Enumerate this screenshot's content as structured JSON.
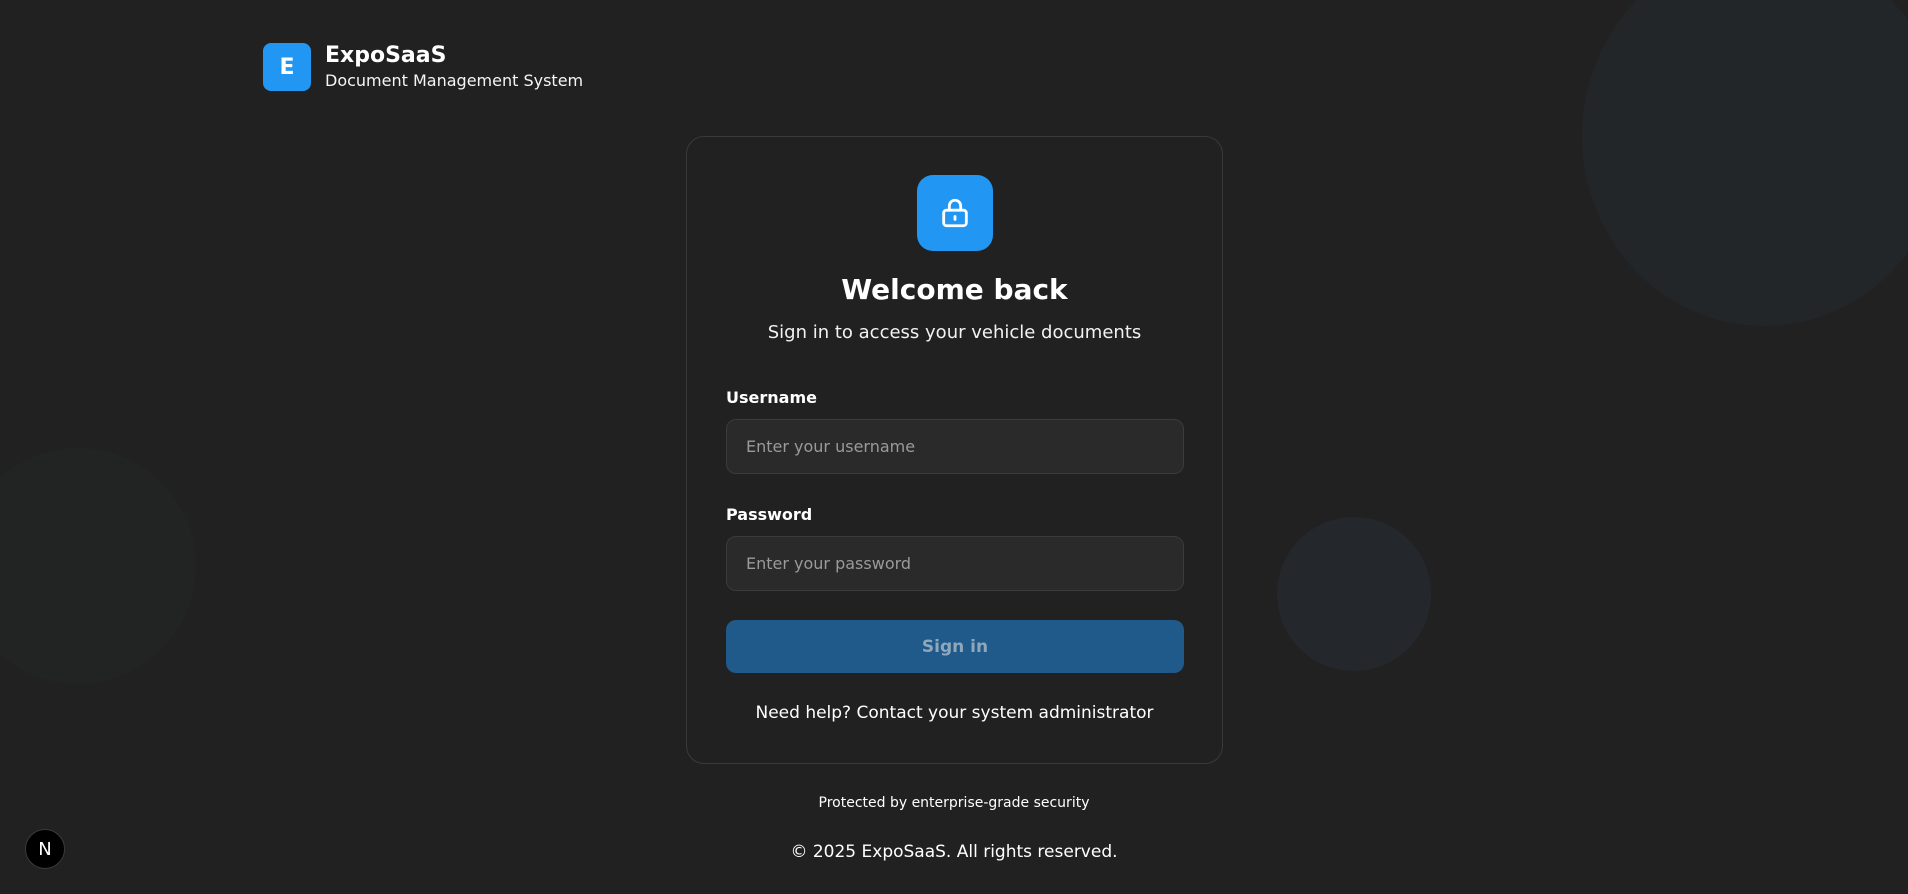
{
  "brand": {
    "logo_letter": "E",
    "name": "ExpoSaaS",
    "subtitle": "Document Management System"
  },
  "login": {
    "title": "Welcome back",
    "subtitle": "Sign in to access your vehicle documents",
    "username_label": "Username",
    "username_placeholder": "Enter your username",
    "username_value": "",
    "password_label": "Password",
    "password_placeholder": "Enter your password",
    "password_value": "",
    "submit_label": "Sign in",
    "help_prefix": "Need help? ",
    "help_link": "Contact your system administrator"
  },
  "footer": {
    "security_note": "Protected by enterprise-grade security",
    "copyright": "© 2025 ExpoSaaS. All rights reserved."
  },
  "badge": {
    "label": "N"
  },
  "icons": {
    "lock": "lock-icon"
  },
  "colors": {
    "accent": "#2196f3",
    "background": "#212121",
    "button_disabled": "#1f5a8a"
  }
}
